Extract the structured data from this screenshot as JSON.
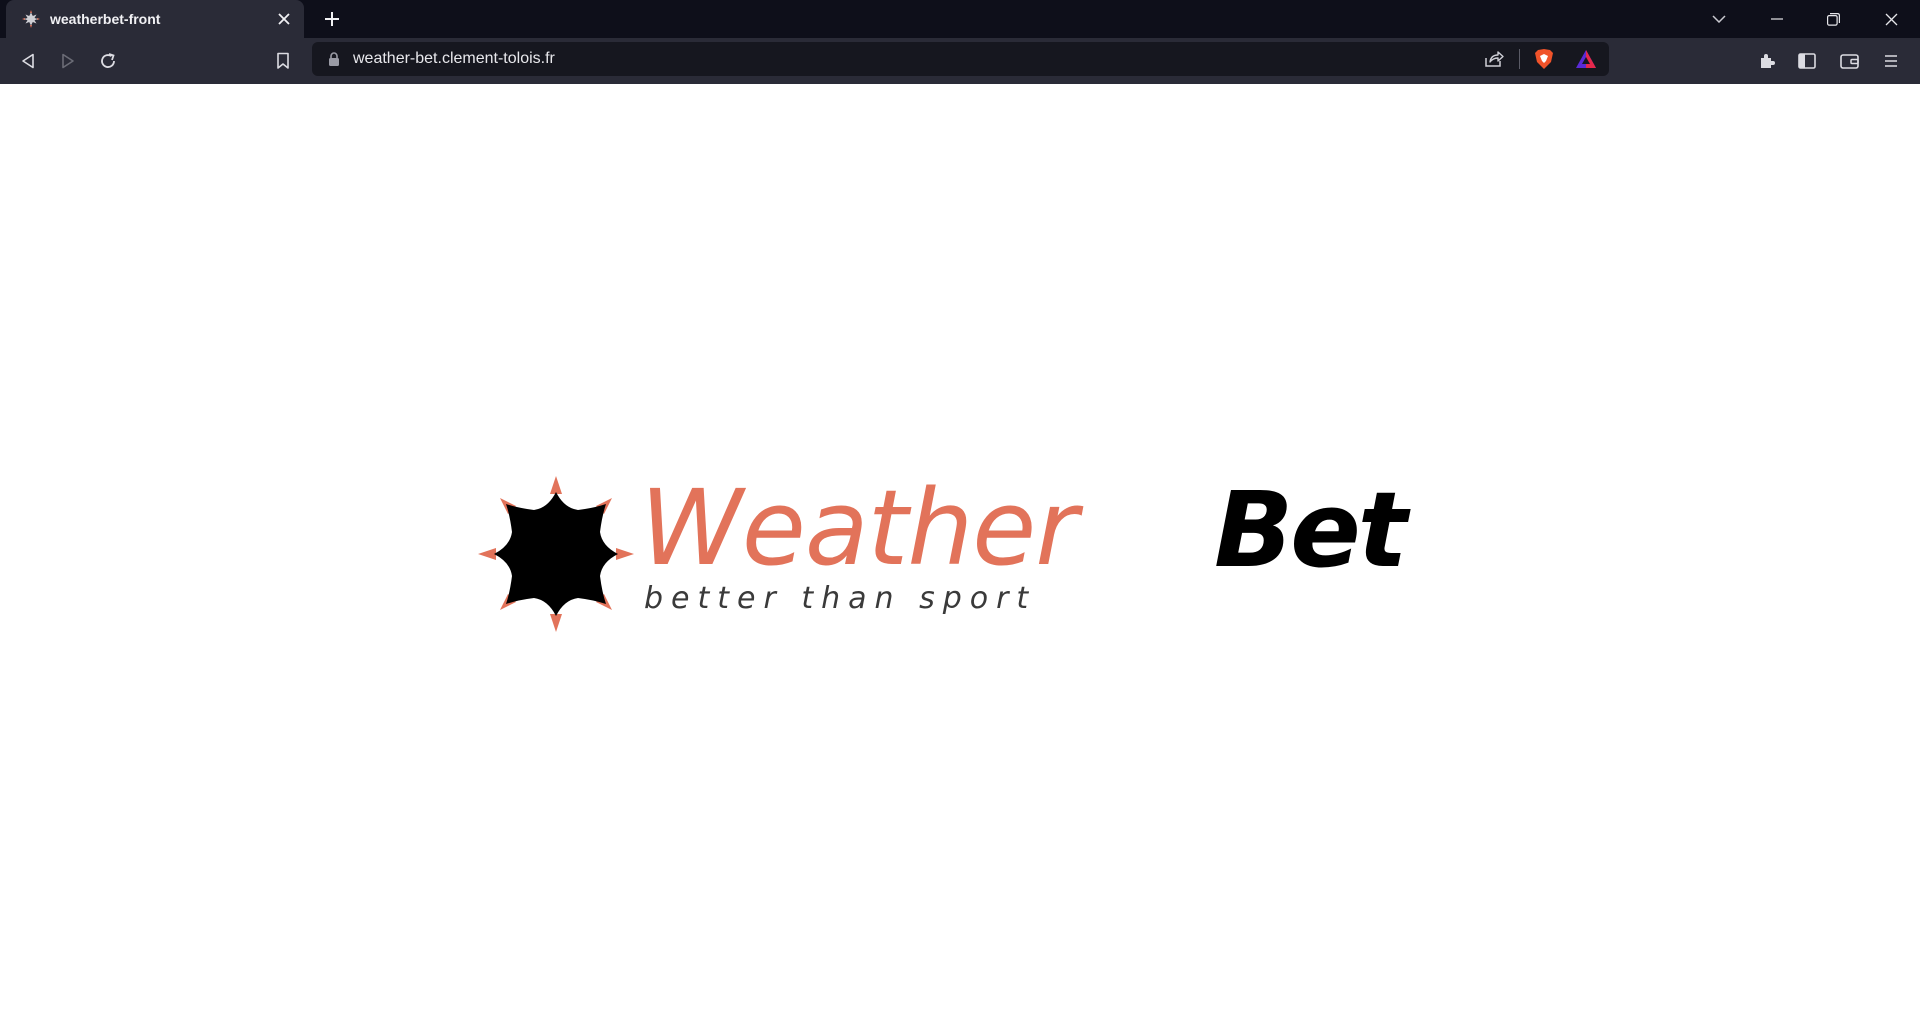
{
  "tab": {
    "title": "weatherbet-front",
    "favicon": "weatherbet-sun-icon"
  },
  "addressbar": {
    "url": "weather-bet.clement-tolois.fr"
  },
  "logo": {
    "word_main": "Weather",
    "word_bold": "Bet",
    "tagline": "better than sport",
    "colors": {
      "accent": "#e2735a",
      "dark": "#000000"
    }
  },
  "colors": {
    "tabbar_bg": "#0e0f1a",
    "toolbar_bg": "#2a2b37",
    "omnibox_bg": "#16171f",
    "page_bg": "#ffffff"
  }
}
